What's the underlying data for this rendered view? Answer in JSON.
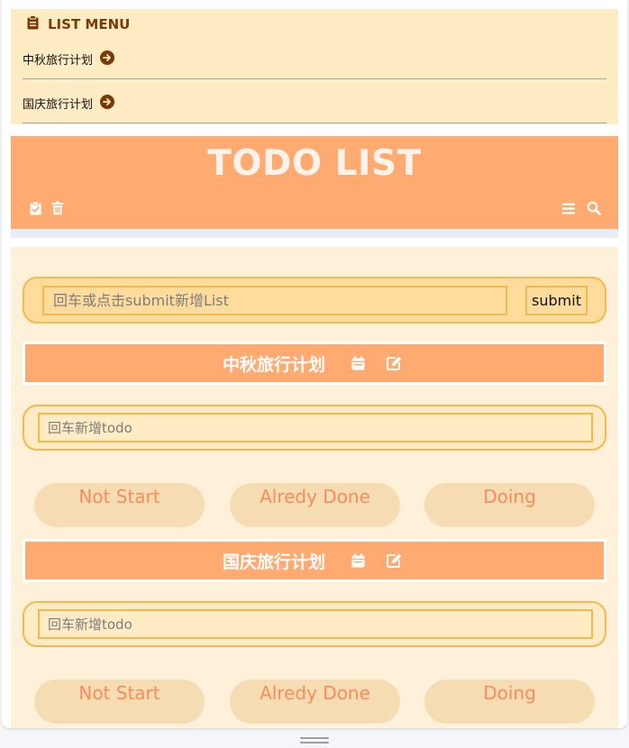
{
  "menu": {
    "title": "LIST MENU",
    "items": [
      {
        "label": "中秋旅行计划"
      },
      {
        "label": "国庆旅行计划"
      }
    ]
  },
  "header": {
    "title": "TODO LIST"
  },
  "add_list": {
    "placeholder": "回车或点击submit新增List",
    "submit_label": "submit"
  },
  "lists": [
    {
      "title": "中秋旅行计划",
      "todo_placeholder": "回车新增todo",
      "statuses": [
        "Not Start",
        "Alredy Done",
        "Doing"
      ]
    },
    {
      "title": "国庆旅行计划",
      "todo_placeholder": "回车新增todo",
      "statuses": [
        "Not Start",
        "Alredy Done",
        "Doing"
      ]
    }
  ],
  "colors": {
    "menu_bg": "#ffebc4",
    "header_bg": "#ffaa71",
    "main_bg": "#fff0d9",
    "input_border": "#f5b74f",
    "pill_bg": "#f5dcb2",
    "pill_text": "#fa8c5a",
    "menu_title": "#7a3a05"
  },
  "icons": {
    "menu_title": "clipboard-icon",
    "menu_item": "arrow-circle-right-icon",
    "header_left": [
      "clipboard-check-icon",
      "trash-icon"
    ],
    "header_right": [
      "menu-icon",
      "search-icon"
    ],
    "list_bar": [
      "calendar-icon",
      "edit-icon"
    ]
  }
}
